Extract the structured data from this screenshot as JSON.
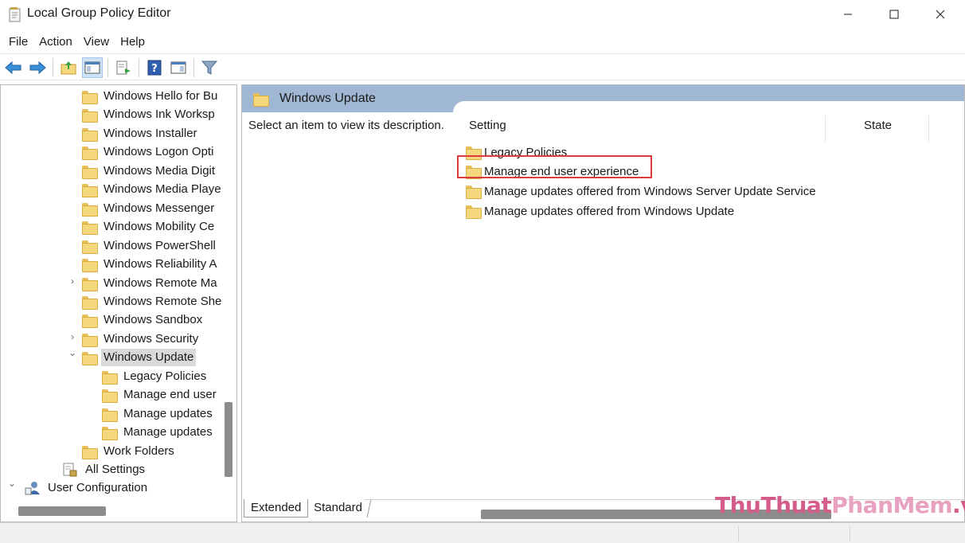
{
  "window": {
    "title": "Local Group Policy Editor"
  },
  "menu": [
    "File",
    "Action",
    "View",
    "Help"
  ],
  "toolbar": {
    "icons": [
      "back-arrow-icon",
      "forward-arrow-icon",
      "up-folder-icon",
      "show-hide-tree-icon",
      "export-list-icon",
      "help-icon",
      "action-pane-icon",
      "filter-icon"
    ]
  },
  "tree": {
    "items": [
      {
        "label": "Windows Hello for Bu",
        "indent": 1
      },
      {
        "label": "Windows Ink Worksp",
        "indent": 1
      },
      {
        "label": "Windows Installer",
        "indent": 1
      },
      {
        "label": "Windows Logon Opti",
        "indent": 1
      },
      {
        "label": "Windows Media Digit",
        "indent": 1
      },
      {
        "label": "Windows Media Playe",
        "indent": 1
      },
      {
        "label": "Windows Messenger",
        "indent": 1
      },
      {
        "label": "Windows Mobility Ce",
        "indent": 1
      },
      {
        "label": "Windows PowerShell",
        "indent": 1
      },
      {
        "label": "Windows Reliability A",
        "indent": 1
      },
      {
        "label": "Windows Remote Ma",
        "indent": 1,
        "expander": "collapsed"
      },
      {
        "label": "Windows Remote She",
        "indent": 1
      },
      {
        "label": "Windows Sandbox",
        "indent": 1
      },
      {
        "label": "Windows Security",
        "indent": 1,
        "expander": "collapsed"
      },
      {
        "label": "Windows Update",
        "indent": 1,
        "expander": "expanded",
        "selected": true
      },
      {
        "label": "Legacy Policies",
        "indent": 2
      },
      {
        "label": "Manage end user",
        "indent": 2
      },
      {
        "label": "Manage updates",
        "indent": 2
      },
      {
        "label": "Manage updates",
        "indent": 2
      },
      {
        "label": "Work Folders",
        "indent": 1
      },
      {
        "label": "All Settings",
        "indent": 0,
        "icon": "all-settings-icon"
      },
      {
        "label": "User Configuration",
        "indent": -1,
        "expander": "expanded",
        "icon": "user-config-icon"
      }
    ]
  },
  "details": {
    "header_title": "Windows Update",
    "description": "Select an item to view its description.",
    "columns": [
      "Setting",
      "State"
    ],
    "rows": [
      "Legacy Policies",
      "Manage end user experience",
      "Manage updates offered from Windows Server Update Service",
      "Manage updates offered from Windows Update"
    ],
    "highlighted_row": 1,
    "highlight_color": "#e0393e"
  },
  "tabs": [
    "Extended",
    "Standard"
  ],
  "watermark": {
    "part1": "ThuThuat",
    "part2": "PhanMem",
    "part3": ".vn"
  }
}
